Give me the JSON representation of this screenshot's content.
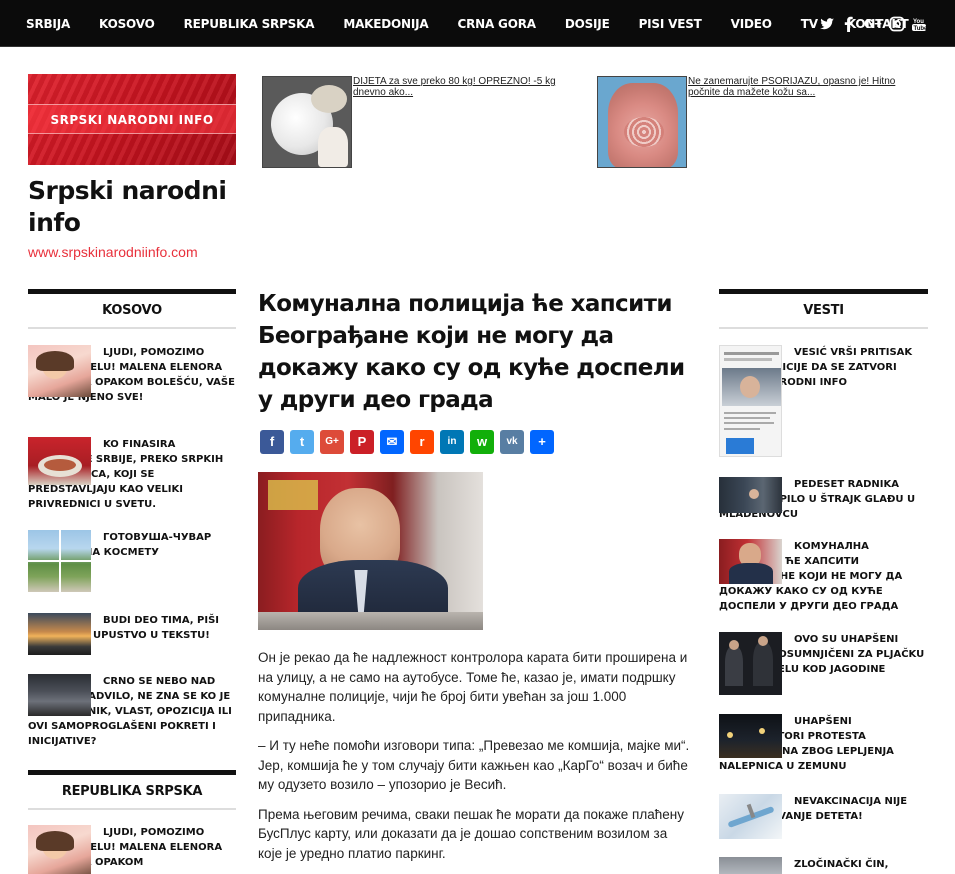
{
  "nav": {
    "items": [
      "SRBIJA",
      "KOSOVO",
      "REPUBLIKA SRPSKA",
      "MAKEDONIJA",
      "CRNA GORA",
      "DOSIJE",
      "PISI VEST",
      "VIDEO",
      "TV",
      "KONTAKT"
    ],
    "social": [
      "twitter-icon",
      "facebook-icon",
      "google-plus-icon",
      "instagram-icon",
      "youtube-icon"
    ]
  },
  "logo": {
    "banner_text": "SRPSKI NARODNI INFO"
  },
  "site": {
    "title": "Srpski narodni info",
    "url": "www.srpskinarodniinfo.com"
  },
  "ads": [
    {
      "text": "DIJETA za sve preko 80 kg! OPREZNO! -5 kg dnevno ako..."
    },
    {
      "text": "Ne zanemarujte PSORIJAZU, opasno je! Hitno počnite da mažete kožu sa..."
    }
  ],
  "left": {
    "kosovo": {
      "heading": "KOSOVO",
      "posts": [
        "LJUDI, POMOZIMO OVOM ANĐELU! MALENA ELENORA SE BORI SA OPAKOM BOLEŠĆU, VAŠE MALO JE NJENO SVE!",
        "KO FINASIRA RAZBIJANJE SRBIJE, PREKO SRPKIH KRIMINALACA, KOJI SE PREDSTAVLJAJU KAO VELIKI PRIVREDNICI U SVETU.",
        "ГОТОВУША-ЧУВАР СРПСТВА НА КОСМЕТУ",
        "BUDI DEO TIMA, PIŠI VEST SAM! UPUSTVO U TEKSTU!",
        "CRNO SE NEBO NAD SRBIJOM NADVILO, NE ZNA SE KO JE VEĆI IZDAJNIK, VLAST, OPOZICIJA ILI OVI SAMOPROGLAŠENI POKRETI I INICIJATIVE?"
      ]
    },
    "rs": {
      "heading": "REPUBLIKA SRPSKA",
      "posts": [
        "LJUDI, POMOZIMO OVOM ANĐELU! MALENA ELENORA SE BORI SA OPAKOM"
      ]
    }
  },
  "right": {
    "heading": "VESTI",
    "posts": [
      "VESIĆ VRŠI PRITISAK PREKO POLICIJE DA SE ZATVORI SRPSKI NARODNI INFO",
      "PEDESET RADNIKA LASTE STUPILO U ŠTRAJK GLAĐU U MLADENOVCU",
      "КОМУНАЛНА ПОЛИЦИЈА ЋЕ ХАПСИТИ БЕОГРАЂАНЕ КОЈИ НЕ МОГУ ДА ДОКАЖУ КАКО СУ ОД КУЋЕ ДОСПЕЛИ У ДРУГИ ДЕО ГРАДА",
      "OVO SU UHAPŠENI POLICAJCI OSUMNJIČENI ZA PLJAČKU POŠTE U SELU KOD JAGODINE (FOTO)",
      "UHAPŠENI ORGANIZATORI PROTESTA 1OD5MILIONA ZBOG LEPLJENJA NALEPNICA U ZEMUNU",
      "NEVAKCINACIJA NIJE ZANEMARIVANJE DETETA!",
      "ZLOČINAČKI ČIN, OPŠTINA"
    ]
  },
  "article": {
    "title": "Комунална полиција ће хапсити Београђане који не могу да докажу како су од куће доспели у други део града",
    "share": [
      {
        "icon": "facebook-icon",
        "color": "#3b5998",
        "glyph": "f"
      },
      {
        "icon": "twitter-icon",
        "color": "#55acee",
        "glyph": "t"
      },
      {
        "icon": "google-plus-icon",
        "color": "#dd4b39",
        "glyph": "G+"
      },
      {
        "icon": "pinterest-icon",
        "color": "#cb2027",
        "glyph": "P"
      },
      {
        "icon": "email-icon",
        "color": "#0166ff",
        "glyph": "✉"
      },
      {
        "icon": "reddit-icon",
        "color": "#ff4500",
        "glyph": "r"
      },
      {
        "icon": "linkedin-icon",
        "color": "#0077b5",
        "glyph": "in"
      },
      {
        "icon": "whatsapp-icon",
        "color": "#12af0a",
        "glyph": "w"
      },
      {
        "icon": "vk-icon",
        "color": "#587ea3",
        "glyph": "vk"
      },
      {
        "icon": "share-icon",
        "color": "#0166ff",
        "glyph": "+"
      }
    ],
    "paragraphs": [
      "Он је рекао да ће надлежност контролора карата бити проширена и на улицу, а не само на аутобусе. Томе ће, казао је, имати подршку комуналне полиције, чији ће број бити увећан за још 1.000 припадника.",
      "– И ту неће помоћи изговори типа: „Превезао ме комшија, мајке ми“. Јер, комшија ће у том случају бити кажњен као „КарГо“ возач и биће му одузето возило – упозорио је Весић.",
      "Према његовим речима, сваки пешак ће морати да покаже плаћену БусПлус карту, или доказати да је дошао сопственим возилом за које је уредно платио паркинг."
    ]
  }
}
